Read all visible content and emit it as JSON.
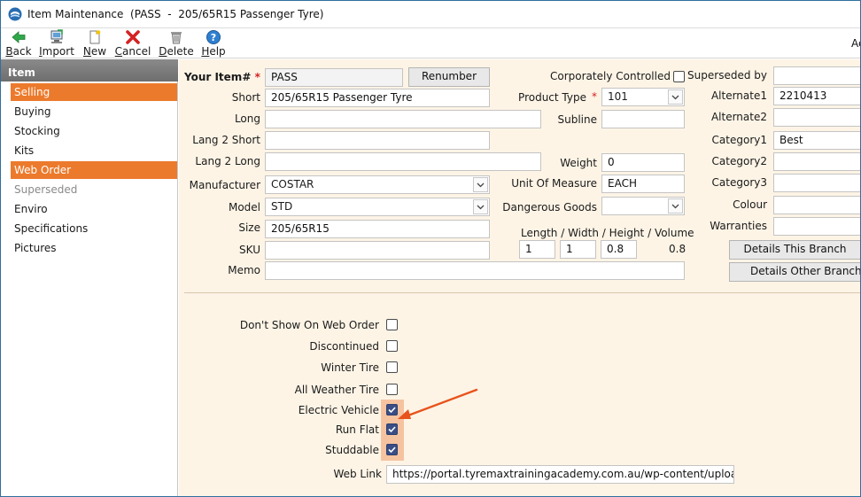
{
  "window": {
    "title": "Item Maintenance  (PASS  -  205/65R15 Passenger Tyre)"
  },
  "toolbar": {
    "buttons": [
      {
        "accel": "B",
        "rest": "ack",
        "icon": "back-arrow-icon"
      },
      {
        "accel": "I",
        "rest": "mport",
        "icon": "import-icon"
      },
      {
        "accel": "N",
        "rest": "ew",
        "icon": "new-document-icon"
      },
      {
        "accel": "C",
        "rest": "ancel",
        "icon": "cancel-x-icon"
      },
      {
        "accel": "D",
        "rest": "elete",
        "icon": "trash-icon"
      },
      {
        "accel": "H",
        "rest": "elp",
        "icon": "help-icon"
      }
    ],
    "cut_label": "Ac"
  },
  "sidebar": {
    "header": "Item",
    "items": [
      {
        "label": "Selling",
        "state": "active"
      },
      {
        "label": "Buying",
        "state": "normal"
      },
      {
        "label": "Stocking",
        "state": "normal"
      },
      {
        "label": "Kits",
        "state": "normal"
      },
      {
        "label": "Web Order",
        "state": "active"
      },
      {
        "label": "Superseded",
        "state": "disabled"
      },
      {
        "label": "Enviro",
        "state": "normal"
      },
      {
        "label": "Specifications",
        "state": "normal"
      },
      {
        "label": "Pictures",
        "state": "normal"
      }
    ]
  },
  "form": {
    "your_item_label": "Your Item#",
    "required_mark": "*",
    "your_item_value": "PASS",
    "renumber_label": "Renumber",
    "short_label": "Short",
    "short_value": "205/65R15 Passenger Tyre",
    "long_label": "Long",
    "long_value": "",
    "lang2_short_label": "Lang 2 Short",
    "lang2_short_value": "",
    "lang2_long_label": "Lang 2 Long",
    "lang2_long_value": "",
    "manufacturer_label": "Manufacturer",
    "manufacturer_value": "COSTAR",
    "model_label": "Model",
    "model_value": "STD",
    "size_label": "Size",
    "size_value": "205/65R15",
    "sku_label": "SKU",
    "sku_value": "",
    "memo_label": "Memo",
    "memo_value": "",
    "corp_controlled_label": "Corporately Controlled",
    "corp_controlled_checked": false,
    "product_type_label": "Product Type",
    "product_type_value": "101",
    "subline_label": "Subline",
    "subline_value": "",
    "weight_label": "Weight",
    "weight_value": "0",
    "uom_label": "Unit Of Measure",
    "uom_value": "EACH",
    "dangerous_goods_label": "Dangerous Goods",
    "dangerous_goods_value": "",
    "dims_label": "Length / Width / Height / Volume",
    "length_value": "1",
    "width_value": "1",
    "height_value": "0.8",
    "volume_value": "0.8",
    "superseded_by_label": "Superseded by",
    "superseded_by_value": "",
    "alternate1_label": "Alternate1",
    "alternate1_value": "2210413",
    "alternate2_label": "Alternate2",
    "alternate2_value": "",
    "category1_label": "Category1",
    "category1_value": "Best",
    "category2_label": "Category2",
    "category2_value": "",
    "category3_label": "Category3",
    "category3_value": "",
    "colour_label": "Colour",
    "colour_value": "",
    "warranties_label": "Warranties",
    "warranties_value": "",
    "details_this_branch_label": "Details This Branch",
    "details_other_branches_label": "Details Other Branches"
  },
  "web_order": {
    "checkboxes": [
      {
        "label": "Don't Show On Web Order",
        "checked": false
      },
      {
        "label": "Discontinued",
        "checked": false
      },
      {
        "label": "Winter Tire",
        "checked": false
      },
      {
        "label": "All Weather Tire",
        "checked": false
      },
      {
        "label": "Electric Vehicle",
        "checked": true
      },
      {
        "label": "Run Flat",
        "checked": true
      },
      {
        "label": "Studdable",
        "checked": true
      }
    ],
    "web_link_label": "Web Link",
    "web_link_value": "https://portal.tyremaxtrainingacademy.com.au/wp-content/uploads/"
  },
  "colors": {
    "accent": "#ec7a2c",
    "panel": "#fdf4e6",
    "checkbox_on": "#3a4e85",
    "annotation_arrow": "#e8531c",
    "annotation_highlight": "#f6c3a0"
  }
}
